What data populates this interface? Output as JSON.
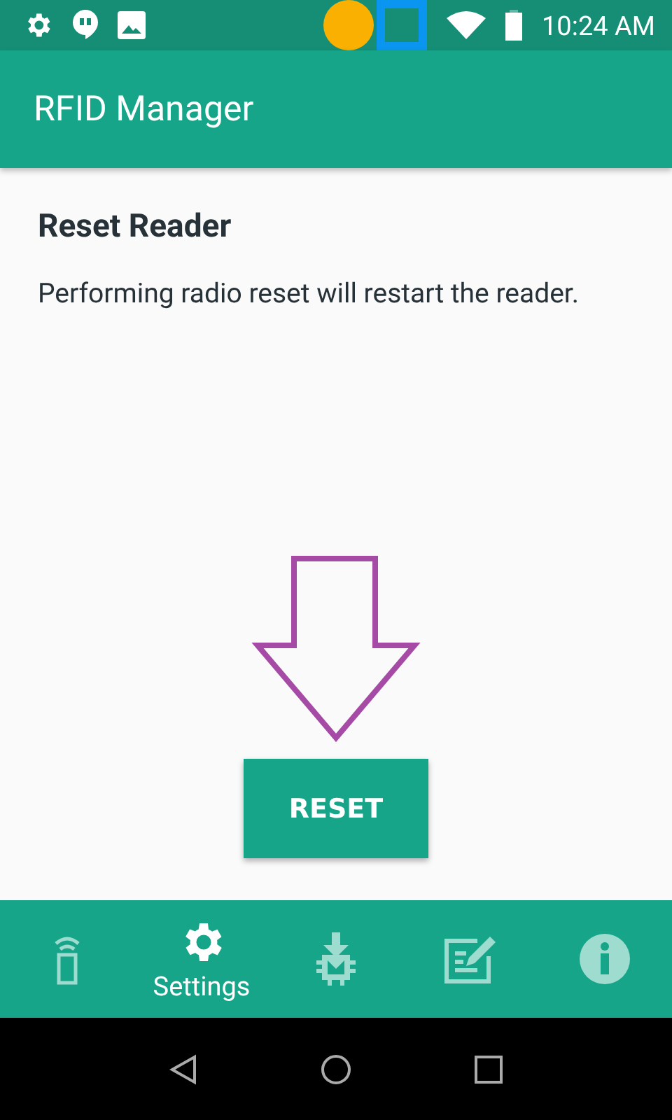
{
  "status_bar": {
    "time": "10:24 AM"
  },
  "app_bar": {
    "title": "RFID Manager"
  },
  "content": {
    "heading": "Reset Reader",
    "description": "Performing radio reset will restart the reader.",
    "button": "RESET"
  },
  "bottom_nav": [
    {
      "kind": "reader",
      "selected": false
    },
    {
      "kind": "settings",
      "selected": true,
      "label": "Settings"
    },
    {
      "kind": "firmware",
      "selected": false
    },
    {
      "kind": "log",
      "selected": false
    },
    {
      "kind": "info",
      "selected": false
    }
  ]
}
